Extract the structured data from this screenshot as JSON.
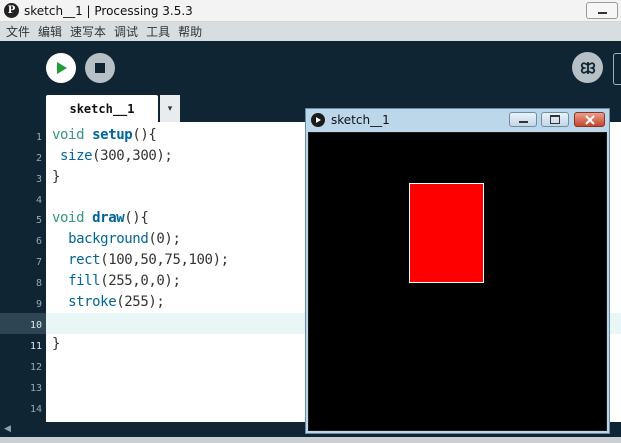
{
  "window": {
    "title": "sketch__1 | Processing 3.5.3",
    "logo_letter": "P"
  },
  "menu": [
    "文件",
    "编辑",
    "速写本",
    "调试",
    "工具",
    "帮助"
  ],
  "tab": {
    "label": "sketch__1",
    "dropdown_glyph": "▾"
  },
  "line_numbers": [
    "1",
    "2",
    "3",
    "4",
    "5",
    "6",
    "7",
    "8",
    "9",
    "10",
    "11",
    "12",
    "13",
    "14"
  ],
  "code": {
    "l1": {
      "kw": "void ",
      "fn": "setup",
      "rest": "(){"
    },
    "l2": {
      "indent": " ",
      "call": "size",
      "rest": "(300,300);"
    },
    "l3": {
      "text": "}"
    },
    "l5": {
      "kw": "void ",
      "fn": "draw",
      "rest": "(){"
    },
    "l6": {
      "indent": "  ",
      "call": "background",
      "rest": "(0);"
    },
    "l7": {
      "indent": "  ",
      "call": "rect",
      "rest": "(100,50,75,100);"
    },
    "l8": {
      "indent": "  ",
      "call": "fill",
      "rest": "(255,0,0);"
    },
    "l9": {
      "indent": "  ",
      "call": "stroke",
      "rest": "(255);"
    },
    "l11": {
      "text": "}"
    }
  },
  "sketch_window": {
    "title": "sketch__1"
  },
  "colors": {
    "editor_bg": "#ffffff",
    "ide_dark": "#0f2533",
    "keyword": "#33997e",
    "function": "#006699",
    "rect_fill": "#ff0000",
    "rect_stroke": "#ffffff",
    "canvas_bg": "#000000"
  }
}
